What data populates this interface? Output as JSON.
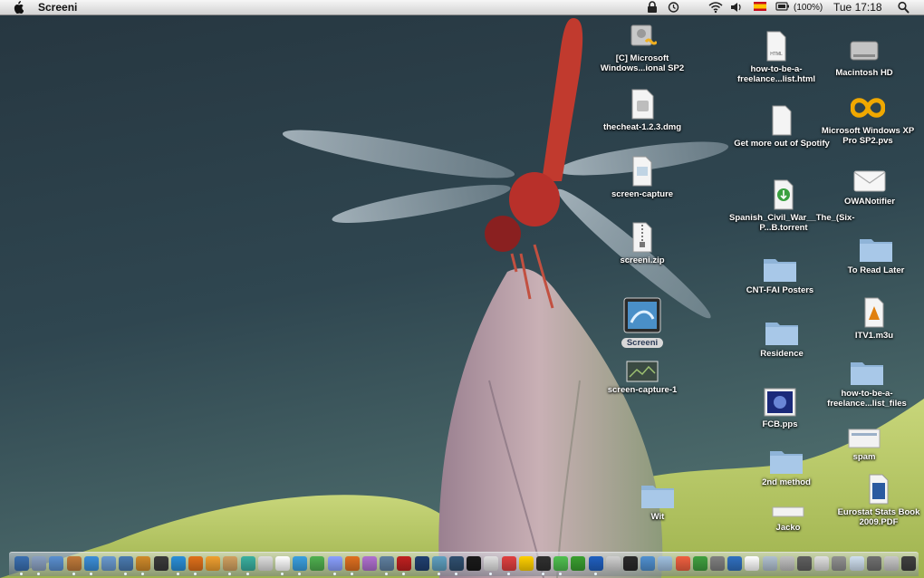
{
  "menubar": {
    "app_name": "Screeni",
    "battery": "(100%)",
    "clock": "Tue 17:18"
  },
  "desktop_icons": {
    "win_iso": "[C] Microsoft Windows...ional SP2",
    "thecheat": "thecheat-1.2.3.dmg",
    "screen_capture": "screen-capture",
    "screeni_zip": "screeni.zip",
    "screeni_app": "Screeni",
    "screen_capture_1": "screen-capture-1",
    "wit": "Wit",
    "howto_html": "how-to-be-a-freelance...list.html",
    "spotify": "Get more out of Spotify",
    "torrent": "Spanish_Civil_War__The_(Six-P...B.torrent",
    "cnt_fai": "CNT-FAI Posters",
    "residence": "Residence",
    "fcb": "FCB.pps",
    "second_method": "2nd method",
    "jacko": "Jacko",
    "macintosh_hd": "Macintosh HD",
    "win_pvs": "Microsoft Windows XP Pro SP2.pvs",
    "owanotifier": "OWANotifier",
    "to_read_later": "To Read Later",
    "itv": "ITV1.m3u",
    "howto_files": "how-to-be-a-freelance...list_files",
    "spam": "spam",
    "eurostat": "Eurostat Stats Book 2009.PDF"
  },
  "colors": {
    "sky_top": "#2b3c45",
    "sky_bottom": "#4a6a6c",
    "leaf": "#b9c96a",
    "bud": "#b89aa0",
    "dragonfly": "#c0362c",
    "folder": "#8fb4d8",
    "selection": "#d9d9d9"
  },
  "dock_colors": [
    "#3a6fb0",
    "#8aa0c0",
    "#5a8fd0",
    "#c07a3a",
    "#3b8ed8",
    "#6a9ad0",
    "#4a7ab0",
    "#d08a2a",
    "#3a3a3a",
    "#2a8fd8",
    "#e0701a",
    "#f0a030",
    "#d0a060",
    "#3ab0a0",
    "#dddddd",
    "#ffffff",
    "#3aa0e0",
    "#50b050",
    "#8aa0ff",
    "#e07020",
    "#b070d0",
    "#6080a0",
    "#c02020",
    "#204070",
    "#60a0c0",
    "#305070",
    "#1a1a1a",
    "#e0e0e0",
    "#e04040",
    "#ffd000",
    "#303030",
    "#50c050",
    "#3aa030",
    "#2060c0",
    "#d0d0d0",
    "#2a2a2a",
    "#5090d0",
    "#a0c0e0",
    "#f06040",
    "#40a040",
    "#808080",
    "#3070c0",
    "#ffffff",
    "#b0c0d0",
    "#c0c0c0",
    "#606060",
    "#e0e0e0",
    "#909090",
    "#d0e0f0",
    "#707070",
    "#c8c8c8",
    "#404040"
  ]
}
